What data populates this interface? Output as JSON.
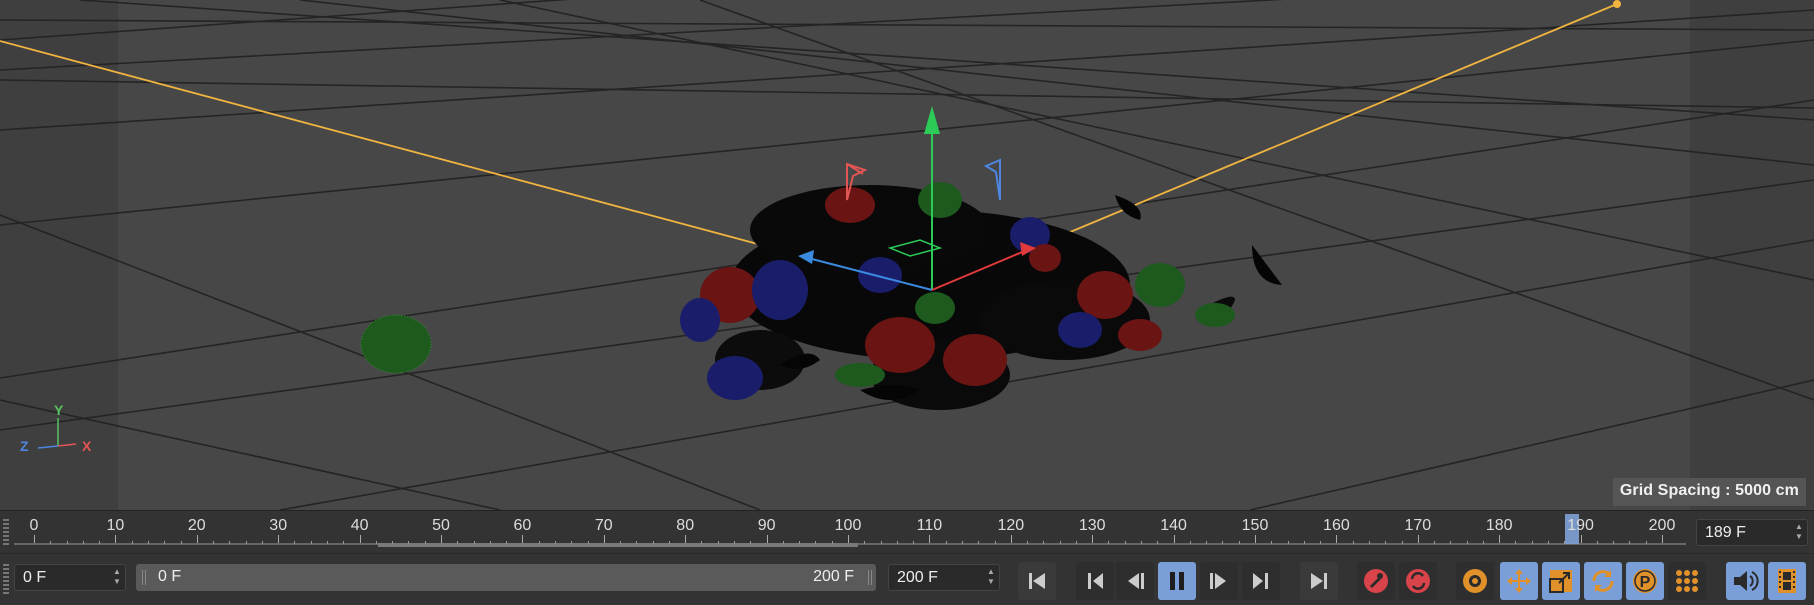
{
  "viewport": {
    "grid_spacing_label": "Grid Spacing : 5000 cm",
    "axis_labels": {
      "y": "Y",
      "z": "Z",
      "x": "X"
    },
    "colors": {
      "background": "#474747",
      "grid_line": "#222222",
      "camera_line": "#f0b440",
      "axis_x": "#e25555",
      "axis_y": "#56c35e",
      "axis_z": "#4e86e0"
    }
  },
  "timeline": {
    "ticks": [
      "0",
      "10",
      "20",
      "30",
      "40",
      "50",
      "60",
      "70",
      "80",
      "90",
      "100",
      "110",
      "120",
      "130",
      "140",
      "150",
      "160",
      "170",
      "180",
      "190",
      "200"
    ],
    "current_frame": "189 F",
    "playhead_frame": 189,
    "max_frame": 200
  },
  "controls": {
    "min_frame": "0 F",
    "preview_start": "0 F",
    "preview_end": "200 F",
    "max_frame": "200 F",
    "buttons": [
      {
        "id": "go-to-start",
        "icon": "go-to-start-icon"
      },
      {
        "id": "go-to-previous-key",
        "icon": "previous-key-icon"
      },
      {
        "id": "previous-frame",
        "icon": "previous-frame-icon"
      },
      {
        "id": "pause",
        "icon": "pause-icon"
      },
      {
        "id": "next-frame",
        "icon": "next-frame-icon"
      },
      {
        "id": "go-to-next-key",
        "icon": "next-key-icon"
      },
      {
        "id": "go-to-end",
        "icon": "go-to-end-icon"
      },
      {
        "id": "record-active-objects",
        "icon": "record-key-icon"
      },
      {
        "id": "autokeying",
        "icon": "autokey-icon"
      },
      {
        "id": "keyframe-selection",
        "icon": "keyframe-selection-icon"
      },
      {
        "id": "position-track",
        "icon": "move-icon"
      },
      {
        "id": "scale-track",
        "icon": "scale-icon"
      },
      {
        "id": "rotation-track",
        "icon": "rotate-icon"
      },
      {
        "id": "parameter-track",
        "icon": "parameter-icon"
      },
      {
        "id": "point-level-animation",
        "icon": "point-grid-icon"
      },
      {
        "id": "sound-playback",
        "icon": "speaker-icon"
      },
      {
        "id": "playback-rate",
        "icon": "film-strip-icon"
      }
    ]
  }
}
